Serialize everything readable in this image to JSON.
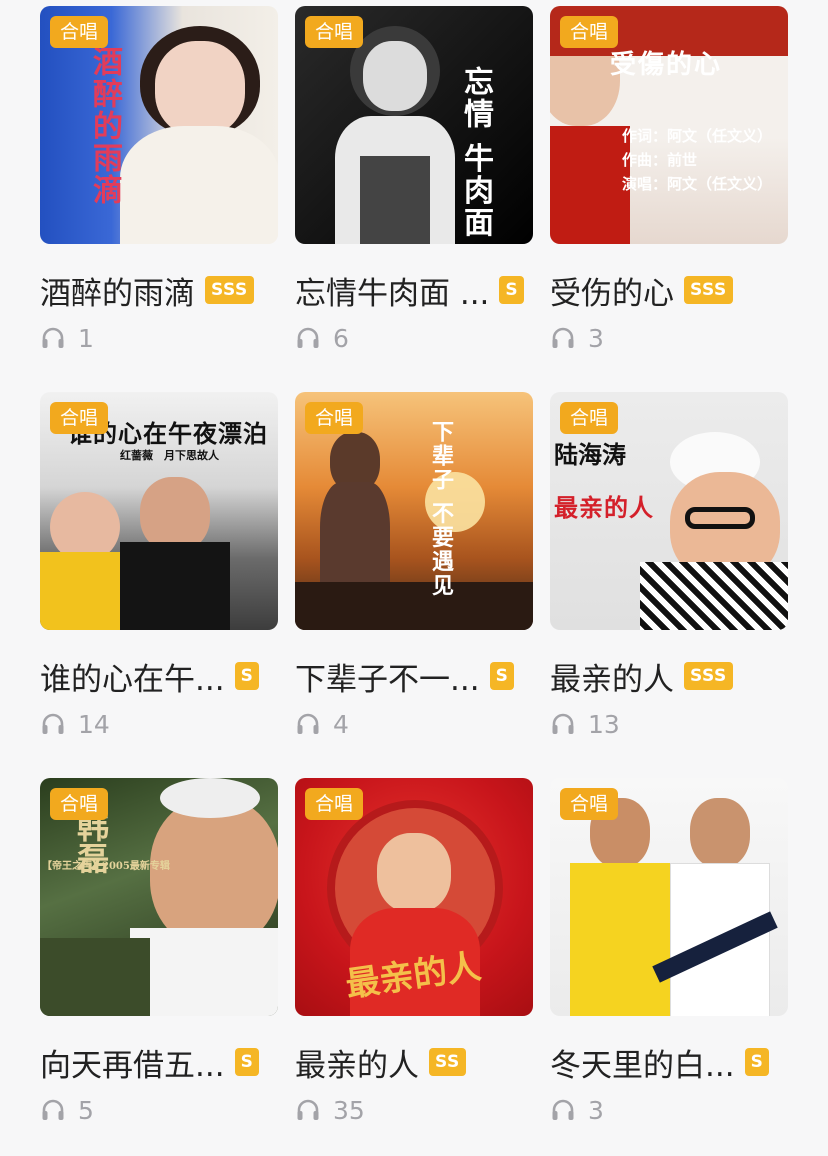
{
  "cards": [
    {
      "tag": "合唱",
      "title": "酒醉的雨滴",
      "badge": "SSS",
      "count": "1",
      "cover": {
        "bg": "#2d57c4",
        "text": "酒醉的雨滴",
        "text_color": "#e23c5a"
      }
    },
    {
      "tag": "合唱",
      "title": "忘情牛肉面 ...",
      "badge": "S",
      "count": "6",
      "cover": {
        "bg": "#1c1c1c",
        "text": "忘情 牛肉面",
        "text_color": "#ffffff"
      }
    },
    {
      "tag": "合唱",
      "title": "受伤的心",
      "badge": "SSS",
      "count": "3",
      "cover": {
        "bg": "#b51f12",
        "text": "受傷的心",
        "text_color": "#ffffff",
        "lines": [
          "作词：阿文（任文义）",
          "作曲：前世",
          "演唱：阿文（任文义）"
        ]
      }
    },
    {
      "tag": "合唱",
      "title": "谁的心在午...",
      "badge": "S",
      "count": "14",
      "cover": {
        "bg": "#c9c9c9",
        "text": "谁的心在午夜漂泊",
        "text_color": "#111111",
        "lines": [
          "红蔷薇　月下思故人"
        ]
      }
    },
    {
      "tag": "合唱",
      "title": "下辈子不一...",
      "badge": "S",
      "count": "4",
      "cover": {
        "bg": "#d9792b",
        "text": "下辈子 不要遇见",
        "text_color": "#ffffff"
      }
    },
    {
      "tag": "合唱",
      "title": "最亲的人",
      "badge": "SSS",
      "count": "13",
      "cover": {
        "bg": "#e8e8e8",
        "text": "最亲的人",
        "text_color": "#d4202a",
        "lines": [
          "陆海涛"
        ]
      }
    },
    {
      "tag": "合唱",
      "title": "向天再借五...",
      "badge": "S",
      "count": "5",
      "cover": {
        "bg": "#4f6a3a",
        "text": "韩磊",
        "text_color": "#e5d39b",
        "lines": [
          "【帝王之声】2005最新专辑"
        ]
      }
    },
    {
      "tag": "合唱",
      "title": "最亲的人",
      "badge": "SS",
      "count": "35",
      "cover": {
        "bg": "#c8151b",
        "text": "最亲的人",
        "text_color": "#f4c04a"
      }
    },
    {
      "tag": "合唱",
      "title": "冬天里的白...",
      "badge": "S",
      "count": "3",
      "cover": {
        "bg": "#f2f2f2",
        "text": "",
        "text_color": "#111111"
      }
    }
  ]
}
